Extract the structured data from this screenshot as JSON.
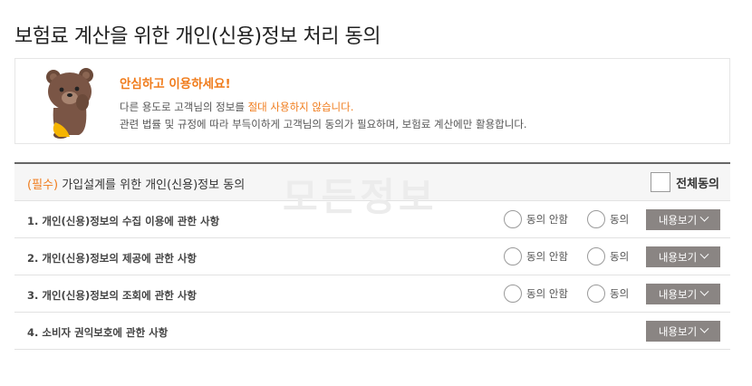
{
  "page": {
    "title": "보험료 계산을 위한 개인(신용)정보 처리 동의"
  },
  "notice": {
    "heading": "안심하고 이용하세요!",
    "line1_before": "다른 용도로 고객님의 정보를 ",
    "line1_highlight": "절대 사용하지 않습니다.",
    "line2": "관련 법률 및 규정에 따라 부득이하게 고객님의 동의가 필요하며, 보험료 계산에만 활용합니다.",
    "mascot_icon": "bear-mascot-icon"
  },
  "section": {
    "required_tag": "(필수)",
    "title": " 가입설계를 위한 개인(신용)정보 동의",
    "all_agree_label": "전체동의",
    "watermark": "모든정보"
  },
  "rows": [
    {
      "label": "1. 개인(신용)정보의 수집 이용에 관한 사항",
      "disagree": "동의 안함",
      "agree": "동의",
      "view": "내용보기"
    },
    {
      "label": "2. 개인(신용)정보의 제공에 관한 사항",
      "disagree": "동의 안함",
      "agree": "동의",
      "view": "내용보기"
    },
    {
      "label": "3. 개인(신용)정보의 조회에 관한 사항",
      "disagree": "동의 안함",
      "agree": "동의",
      "view": "내용보기"
    },
    {
      "label": "4. 소비자 권익보호에 관한 사항",
      "view": "내용보기"
    }
  ],
  "colors": {
    "accent": "#f07c1c",
    "button": "#8a8583"
  }
}
